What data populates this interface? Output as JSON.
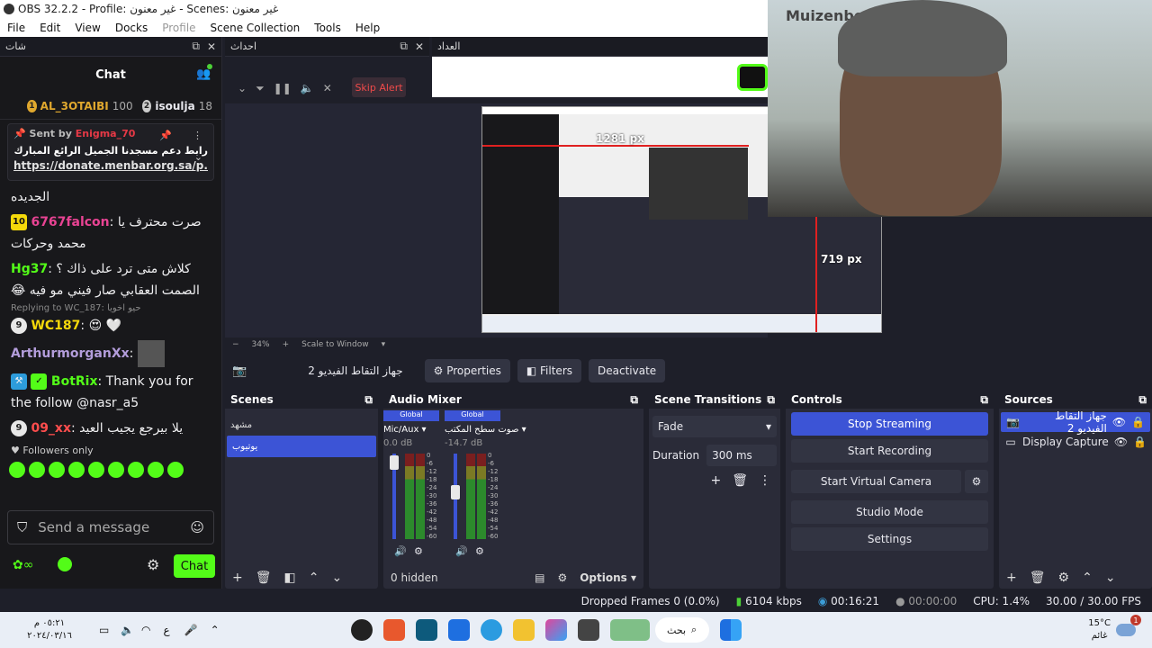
{
  "window": {
    "title": "OBS 32.2.2 - Profile: غير معنون - Scenes: غير معنون"
  },
  "menu": [
    "File",
    "Edit",
    "View",
    "Docks",
    "Profile",
    "Scene Collection",
    "Tools",
    "Help"
  ],
  "chat_dock": {
    "dock_title": "شات",
    "header": "Chat",
    "leaders": [
      {
        "rank": "1",
        "name": "AL_3OTAIBI",
        "count": "100"
      },
      {
        "rank": "2",
        "name": "isoulja",
        "count": "18"
      }
    ],
    "pinned": {
      "sent_by_label": "Sent by",
      "sent_by_user": "Enigma_70",
      "message": "رابط دعم مسجدنا الجميل الرائع المبارك",
      "link": "https://donate.menbar.org.sa/p..."
    },
    "messages": [
      {
        "text": "الجديده"
      },
      {
        "badge": "10",
        "user": "6767falcon",
        "text": "صرت محترف يا محمد وحركات"
      },
      {
        "user": "Hg37",
        "text": "كلاش متى ترد على ذاك ؟ الصمت العقابي صار فيني مو فيه 😂"
      },
      {
        "reply": "Replying to WC_187: حيو اخويا"
      },
      {
        "badge": "9",
        "user": "WC187",
        "text": "😍 🤍"
      },
      {
        "user": "ArthurmorganXx",
        "text": ""
      },
      {
        "user": "BotRix",
        "text": "Thank you for the follow @nasr_a5"
      },
      {
        "badge": "9",
        "user": "09_xx",
        "text": "يلا بيرجع يجيب العيد"
      }
    ],
    "followers_only": "Followers only",
    "send_placeholder": "Send a message",
    "chat_button": "Chat"
  },
  "events_dock": {
    "title": "احداث",
    "skip_alert": "Skip Alert"
  },
  "counter_dock": {
    "title": "العداد"
  },
  "preview": {
    "zoom": "34%",
    "scale_mode": "Scale to Window",
    "width_readout": "1281 px",
    "height_readout": "719 px",
    "camera_sign": "Muizenberg"
  },
  "context_bar": {
    "source_name": "جهاز التقاط الفيديو 2",
    "properties": "Properties",
    "filters": "Filters",
    "deactivate": "Deactivate"
  },
  "scenes": {
    "title": "Scenes",
    "items": [
      "مشهد",
      "يوتيوب"
    ]
  },
  "audio_mixer": {
    "title": "Audio Mixer",
    "channels": [
      {
        "tag": "Global",
        "name": "Mic/Aux",
        "db": "0.0 dB",
        "level": 0.9
      },
      {
        "tag": "Global",
        "name": "صوت سطح المكتب",
        "db": "-14.7 dB",
        "level": 0.55
      }
    ],
    "scale": [
      "0",
      "-6",
      "-12",
      "-18",
      "-24",
      "-30",
      "-36",
      "-42",
      "-48",
      "-54",
      "-60"
    ],
    "hidden": "0 hidden",
    "options": "Options"
  },
  "transitions": {
    "title": "Scene Transitions",
    "selected": "Fade",
    "duration_label": "Duration",
    "duration_value": "300 ms"
  },
  "controls": {
    "title": "Controls",
    "buttons": [
      "Stop Streaming",
      "Start Recording",
      "Start Virtual Camera",
      "Studio Mode",
      "Settings"
    ]
  },
  "sources": {
    "title": "Sources",
    "items": [
      "جهاز التقاط الفيديو 2",
      "Display Capture"
    ]
  },
  "status": {
    "dropped": "Dropped Frames 0 (0.0%)",
    "kbps": "6104 kbps",
    "stream_time": "00:16:21",
    "rec_time": "00:00:00",
    "cpu": "CPU: 1.4%",
    "fps": "30.00 / 30.00 FPS"
  },
  "taskbar": {
    "time": "٠٥:٢١ م",
    "date": "٢٠٢٤/٠٣/١٦",
    "lang": "ع",
    "search": "بحث",
    "weather_temp": "15°C",
    "weather_text": "غائم",
    "notif": "1"
  },
  "colors": {
    "accent": "#3c54d6",
    "kick_green": "#53fc18",
    "bg": "#1e1f29",
    "panel": "#2a2b38"
  }
}
